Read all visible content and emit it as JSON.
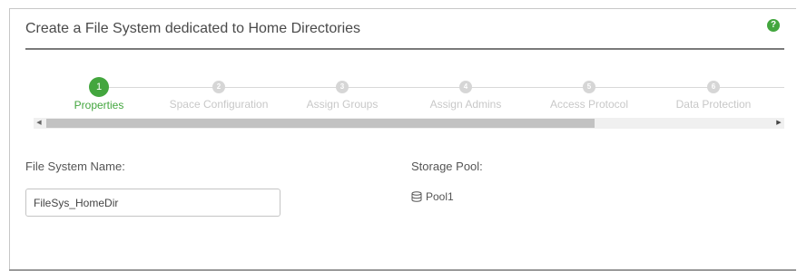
{
  "dialog": {
    "title": "Create a File System dedicated to Home Directories",
    "help_icon": "?"
  },
  "wizard": {
    "active_step": 1,
    "steps": [
      {
        "number": "1",
        "label": "Properties"
      },
      {
        "number": "2",
        "label": "Space Configuration"
      },
      {
        "number": "3",
        "label": "Assign Groups"
      },
      {
        "number": "4",
        "label": "Assign Admins"
      },
      {
        "number": "5",
        "label": "Access Protocol"
      },
      {
        "number": "6",
        "label": "Data Protection"
      }
    ]
  },
  "scrollbar": {
    "left_arrow": "◀",
    "right_arrow": "▶"
  },
  "form": {
    "file_system_name_label": "File System Name:",
    "file_system_name_value": "FileSys_HomeDir",
    "storage_pool_label": "Storage Pool:",
    "storage_pool_value": "Pool1",
    "storage_pool_icon": "database-icon"
  },
  "colors": {
    "accent": "#43a63e",
    "inactive_step": "#d6d6d6"
  }
}
